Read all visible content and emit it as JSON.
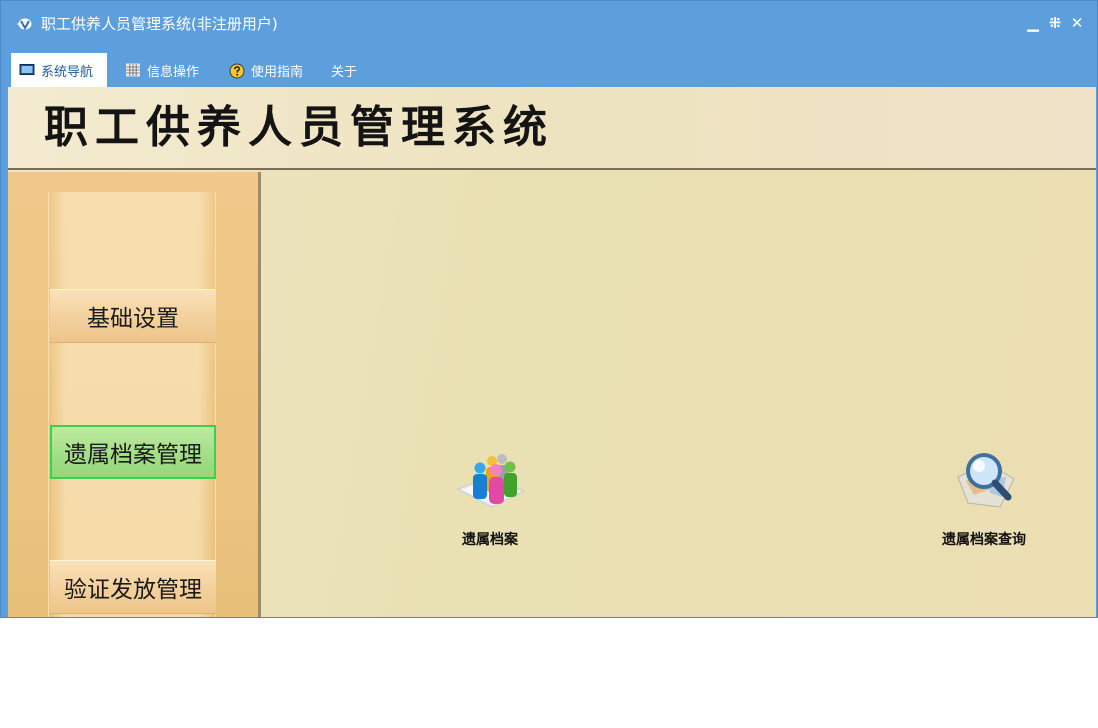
{
  "window": {
    "title": "职工供养人员管理系统(非注册用户)",
    "controls": {
      "minimize": "▁",
      "restore": "⁜",
      "close": "✕"
    }
  },
  "menu": {
    "items": [
      {
        "label": "系统导航",
        "icon": "monitor-icon",
        "active": true
      },
      {
        "label": "信息操作",
        "icon": "grid-icon",
        "active": false
      },
      {
        "label": "使用指南",
        "icon": "help-icon",
        "active": false
      },
      {
        "label": "关于",
        "icon": "",
        "active": false
      }
    ]
  },
  "banner": {
    "title": "职工供养人员管理系统"
  },
  "sidebar": {
    "items": [
      {
        "label": "基础设置",
        "active": false
      },
      {
        "label": "遗属档案管理",
        "active": true
      },
      {
        "label": "验证发放管理",
        "active": false
      }
    ]
  },
  "features": [
    {
      "label": "遗属档案",
      "icon": "people-group-icon"
    },
    {
      "label": "遗属档案查询",
      "icon": "magnifier-search-icon"
    }
  ],
  "colors": {
    "titlebar": "#5c9fdc",
    "active_sidebar": "#a4de88",
    "sidebar": "#eec58a",
    "workspace": "#e9e0b3"
  }
}
